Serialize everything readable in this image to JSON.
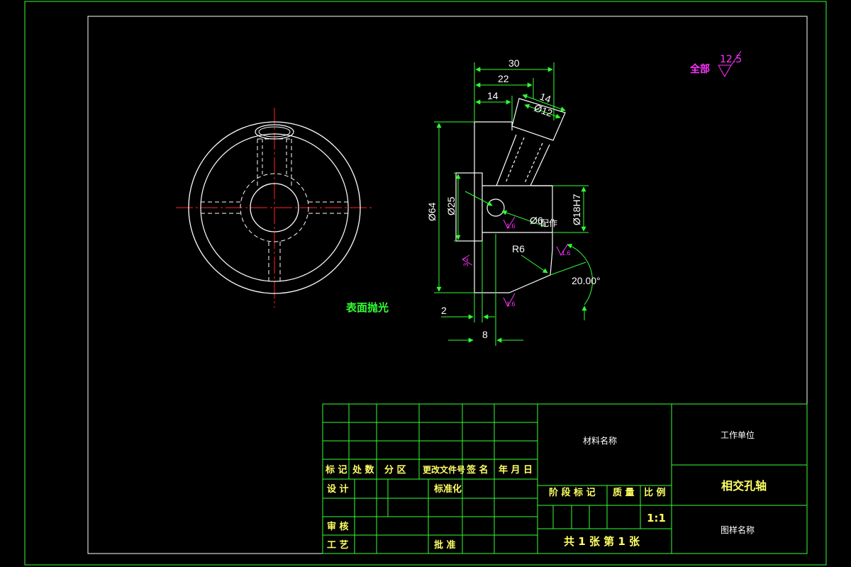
{
  "drawing": {
    "surface_note": "表面抛光",
    "roughness_all_label": "全部",
    "roughness_all_value": "12.5",
    "roughness_marks": [
      "1.6",
      "1.6",
      "1.6",
      "3.2",
      "3.2"
    ],
    "dimensions": {
      "d30": "30",
      "d22": "22",
      "d14a": "14",
      "d14b": "14",
      "d12": "Ø12",
      "d64": "Ø64",
      "d25": "Ø25",
      "d18": "Ø18H7",
      "d6": "Ø6",
      "d6_note": "配作",
      "r6": "R6",
      "angle": "20.00°",
      "d2": "2",
      "d8": "8"
    }
  },
  "title_block": {
    "revision_headers": [
      "标 记",
      "处 数",
      "分 区",
      "更改文件号",
      "签 名",
      "年 月 日"
    ],
    "design": "设 计",
    "standardize": "标准化",
    "review": "审 核",
    "process": "工 艺",
    "approve": "批 准",
    "material": "材料名称",
    "stage_mark": "阶 段 标 记",
    "weight": "质 量",
    "scale_label": "比 例",
    "scale_value": "1:1",
    "sheets": "共 1 张   第 1 张",
    "unit": "工作单位",
    "part_name": "相交孔轴",
    "drawing_name": "图样名称"
  }
}
